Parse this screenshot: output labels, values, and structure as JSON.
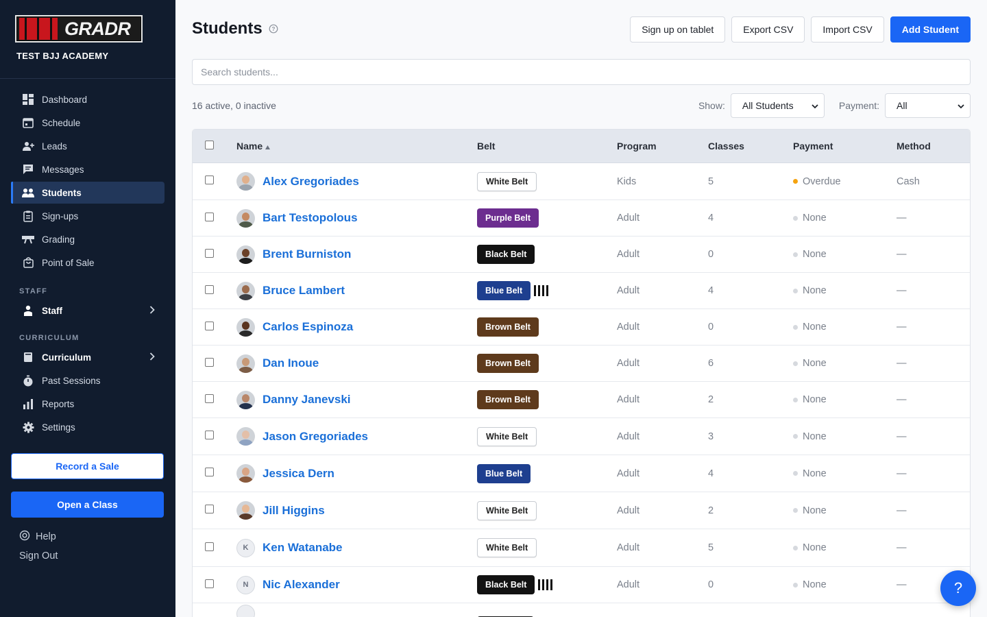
{
  "brand": {
    "logo_text": "GRADR",
    "academy": "TEST BJJ ACADEMY"
  },
  "nav": [
    {
      "label": "Dashboard",
      "icon": "dashboard-icon"
    },
    {
      "label": "Schedule",
      "icon": "calendar-icon"
    },
    {
      "label": "Leads",
      "icon": "add-person-icon"
    },
    {
      "label": "Messages",
      "icon": "message-icon"
    },
    {
      "label": "Students",
      "icon": "students-icon",
      "active": true
    },
    {
      "label": "Sign-ups",
      "icon": "clipboard-icon"
    },
    {
      "label": "Grading",
      "icon": "grading-icon"
    },
    {
      "label": "Point of Sale",
      "icon": "shopping-bag-icon"
    }
  ],
  "staff_section": {
    "label": "STAFF",
    "item": "Staff"
  },
  "curriculum_section": {
    "label": "CURRICULUM",
    "item": "Curriculum"
  },
  "nav2": [
    {
      "label": "Past Sessions",
      "icon": "stopwatch-icon"
    },
    {
      "label": "Reports",
      "icon": "bar-chart-icon"
    },
    {
      "label": "Settings",
      "icon": "gear-icon"
    }
  ],
  "sidebar_actions": {
    "record_sale": "Record a Sale",
    "open_class": "Open a Class",
    "help": "Help",
    "sign_out": "Sign Out"
  },
  "header": {
    "title": "Students",
    "buttons": {
      "signup_tablet": "Sign up on tablet",
      "export_csv": "Export CSV",
      "import_csv": "Import CSV",
      "add_student": "Add Student"
    }
  },
  "search": {
    "placeholder": "Search students..."
  },
  "counts_text": "16 active, 0 inactive",
  "filters": {
    "show_label": "Show:",
    "show_value": "All Students",
    "payment_label": "Payment:",
    "payment_value": "All"
  },
  "table": {
    "columns": {
      "name": "Name",
      "belt": "Belt",
      "program": "Program",
      "classes": "Classes",
      "payment": "Payment",
      "method": "Method"
    },
    "rows": [
      {
        "name": "Alex Gregoriades",
        "belt": "White Belt",
        "belt_color": "white",
        "stripes": 0,
        "program": "Kids",
        "classes": "5",
        "payment": "Overdue",
        "dot": "#f5a30f",
        "method": "Cash",
        "avatar": {
          "type": "photo",
          "skin": "#e0b08c",
          "shirt": "#9aa3ad"
        }
      },
      {
        "name": "Bart Testopolous",
        "belt": "Purple Belt",
        "belt_color": "purple",
        "stripes": 0,
        "program": "Adult",
        "classes": "4",
        "payment": "None",
        "dot": "#d6d9de",
        "method": "—",
        "avatar": {
          "type": "photo",
          "skin": "#c48a62",
          "shirt": "#4f5a49"
        }
      },
      {
        "name": "Brent Burniston",
        "belt": "Black Belt",
        "belt_color": "black",
        "stripes": 0,
        "program": "Adult",
        "classes": "0",
        "payment": "None",
        "dot": "#d6d9de",
        "method": "—",
        "avatar": {
          "type": "photo",
          "skin": "#6b4128",
          "shirt": "#1d1d1d"
        }
      },
      {
        "name": "Bruce Lambert",
        "belt": "Blue Belt",
        "belt_color": "blue",
        "stripes": 4,
        "program": "Adult",
        "classes": "4",
        "payment": "None",
        "dot": "#d6d9de",
        "method": "—",
        "avatar": {
          "type": "photo",
          "skin": "#9a6b4d",
          "shirt": "#3b3f45"
        }
      },
      {
        "name": "Carlos Espinoza",
        "belt": "Brown Belt",
        "belt_color": "brown",
        "stripes": 0,
        "program": "Adult",
        "classes": "0",
        "payment": "None",
        "dot": "#d6d9de",
        "method": "—",
        "avatar": {
          "type": "photo",
          "skin": "#5a3420",
          "shirt": "#2a2a2a"
        }
      },
      {
        "name": "Dan Inoue",
        "belt": "Brown Belt",
        "belt_color": "brown",
        "stripes": 0,
        "program": "Adult",
        "classes": "6",
        "payment": "None",
        "dot": "#d6d9de",
        "method": "—",
        "avatar": {
          "type": "photo",
          "skin": "#c89a78",
          "shirt": "#7d5d46"
        }
      },
      {
        "name": "Danny Janevski",
        "belt": "Brown Belt",
        "belt_color": "brown",
        "stripes": 0,
        "program": "Adult",
        "classes": "2",
        "payment": "None",
        "dot": "#d6d9de",
        "method": "—",
        "avatar": {
          "type": "photo",
          "skin": "#b9876a",
          "shirt": "#24324d"
        }
      },
      {
        "name": "Jason Gregoriades",
        "belt": "White Belt",
        "belt_color": "white",
        "stripes": 0,
        "program": "Adult",
        "classes": "3",
        "payment": "None",
        "dot": "#d6d9de",
        "method": "—",
        "avatar": {
          "type": "photo",
          "skin": "#e3bfa8",
          "shirt": "#8fa3c2"
        }
      },
      {
        "name": "Jessica Dern",
        "belt": "Blue Belt",
        "belt_color": "blue",
        "stripes": 0,
        "program": "Adult",
        "classes": "4",
        "payment": "None",
        "dot": "#d6d9de",
        "method": "—",
        "avatar": {
          "type": "photo",
          "skin": "#d9a585",
          "shirt": "#8a5a3c"
        }
      },
      {
        "name": "Jill Higgins",
        "belt": "White Belt",
        "belt_color": "white",
        "stripes": 0,
        "program": "Adult",
        "classes": "2",
        "payment": "None",
        "dot": "#d6d9de",
        "method": "—",
        "avatar": {
          "type": "photo",
          "skin": "#e6b895",
          "shirt": "#5a3a2a"
        }
      },
      {
        "name": "Ken Watanabe",
        "belt": "White Belt",
        "belt_color": "white",
        "stripes": 0,
        "program": "Adult",
        "classes": "5",
        "payment": "None",
        "dot": "#d6d9de",
        "method": "—",
        "avatar": {
          "type": "initial",
          "letter": "K"
        }
      },
      {
        "name": "Nic Alexander",
        "belt": "Black Belt",
        "belt_color": "black",
        "stripes": 4,
        "program": "Adult",
        "classes": "0",
        "payment": "None",
        "dot": "#d6d9de",
        "method": "—",
        "avatar": {
          "type": "initial",
          "letter": "N"
        }
      },
      {
        "name": "",
        "belt": "",
        "belt_color": "black",
        "stripes": 0,
        "program": "",
        "classes": "",
        "payment": "",
        "dot": "",
        "method": "",
        "avatar": {
          "type": "initial",
          "letter": ""
        }
      }
    ]
  },
  "fab": "?"
}
